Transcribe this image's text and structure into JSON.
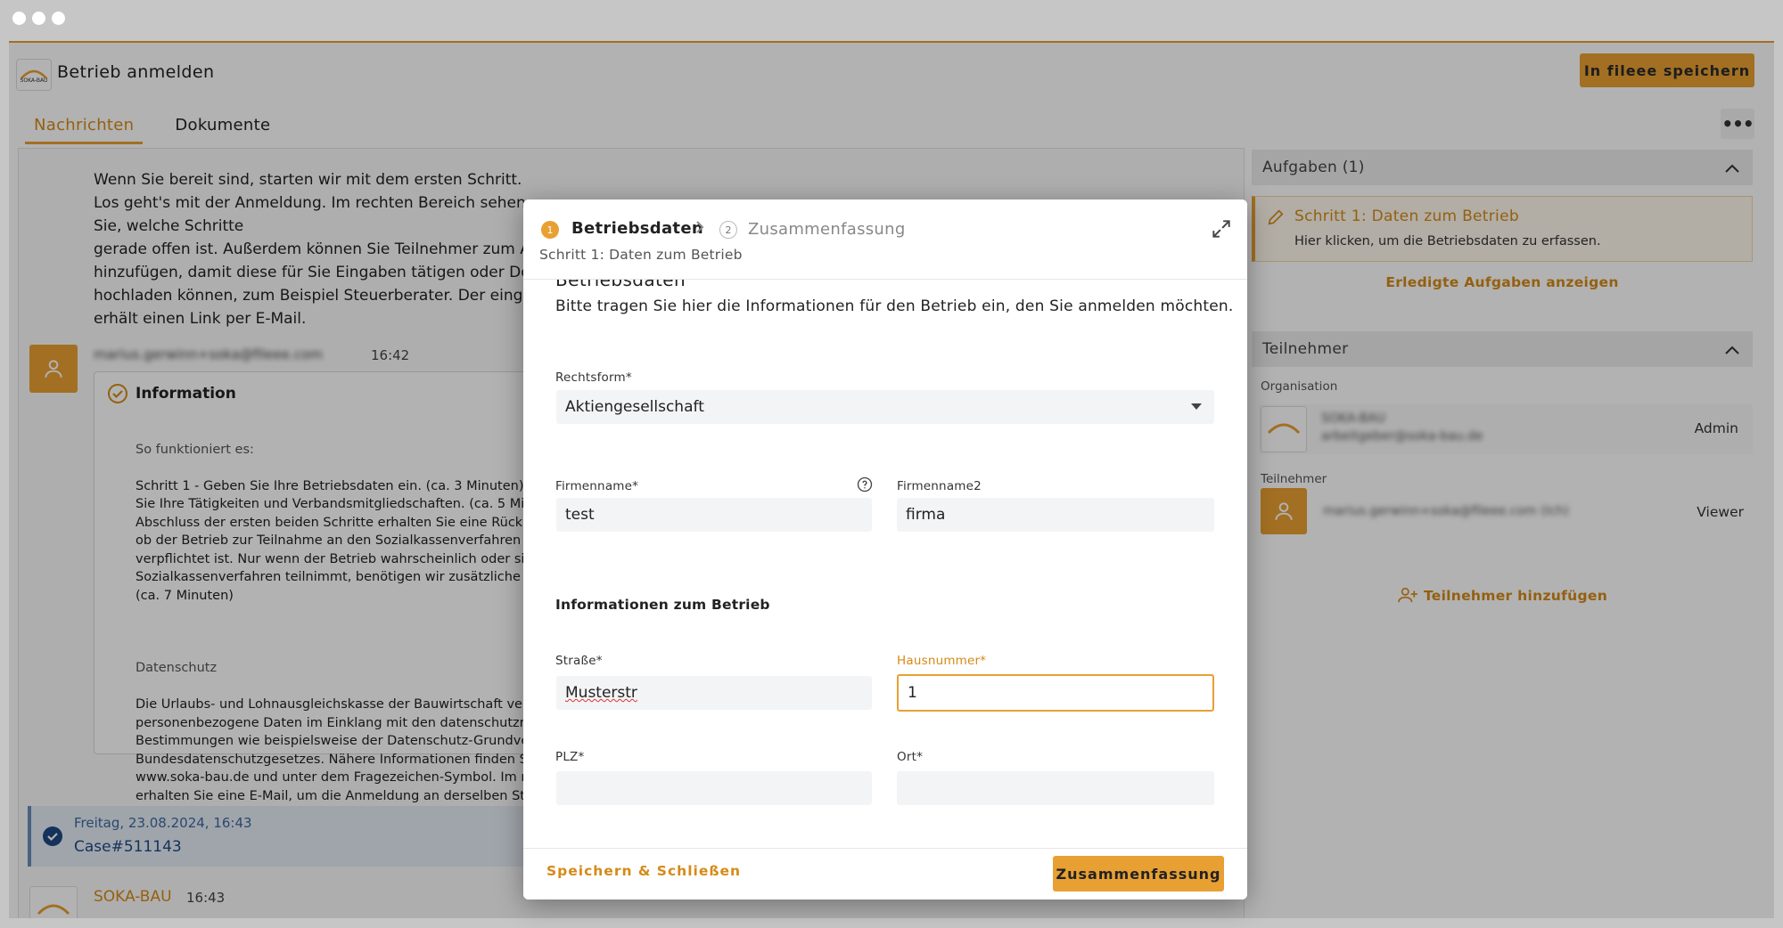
{
  "header": {
    "title": "Betrieb anmelden",
    "save_button": "In fileee speichern",
    "logo_text": "SOKA-BAU"
  },
  "tabs": [
    {
      "label": "Nachrichten",
      "active": true
    },
    {
      "label": "Dokumente",
      "active": false
    }
  ],
  "more_label": "•••",
  "chat": {
    "intro_text": "Wenn Sie bereit sind, starten wir mit dem ersten Schritt.\nLos geht's mit der Anmeldung. Im rechten Bereich sehen Sie, welche Schritte\ngerade offen ist. Außerdem können Sie Teilnehmer zum Ar\nhinzufügen, damit diese für Sie Eingaben tätigen oder Dok\nhochladen können, zum Beispiel Steuerberater. Der eingel\nerhält einen Link per E-Mail.",
    "message": {
      "sender": "marius.gerwinn+soka@fileee.com",
      "time": "16:42",
      "card_title": "Information",
      "how_heading": "So funktioniert es:",
      "how_text": "Schritt 1 - Geben Sie Ihre Betriebsdaten ein. (ca. 3 Minuten) S\nSie Ihre Tätigkeiten und Verbandsmitgliedschaften. (ca. 5 Mi\nAbschluss der ersten beiden Schritte erhalten Sie eine Rückm\nob der Betrieb zur Teilnahme an den Sozialkassenverfahren b\nverpflichtet ist. Nur wenn der Betrieb wahrscheinlich oder si\nSozialkassenverfahren teilnimmt, benötigen wir zusätzliche\n(ca. 7 Minuten)",
      "privacy_heading": "Datenschutz",
      "privacy_text": "Die Urlaubs- und Lohnausgleichskasse der Bauwirtschaft ver\npersonenbezogene Daten im Einklang mit den datenschutzre\nBestimmungen wie beispielsweise der Datenschutz-Grundve\nBundesdatenschutzgesetzes. Nähere Informationen finden S\nwww.soka-bau.de und unter dem Fragezeichen-Symbol. Im n\nerhalten Sie eine E-Mail, um die Anmeldung an derselben St"
    },
    "case": {
      "date": "Freitag, 23.08.2024, 16:43",
      "number": "Case#511143"
    },
    "soka_msg": {
      "name": "SOKA-BAU",
      "time": "16:43"
    }
  },
  "right_panel": {
    "tasks_header": "Aufgaben (1)",
    "task_title": "Schritt 1: Daten zum Betrieb",
    "task_sub": "Hier klicken, um die Betriebsdaten zu erfassen.",
    "done_link": "Erledigte Aufgaben anzeigen",
    "participants_header": "Teilnehmer",
    "org_label": "Organisation",
    "org_name": "SOKA-BAU",
    "org_email": "arbeitgeber@soka-bau.de",
    "org_role": "Admin",
    "participants_label": "Teilnehmer",
    "participant_email": "marius.gerwinn+soka@fileee.com (Ich)",
    "participant_role": "Viewer",
    "add_link": "Teilnehmer hinzufügen"
  },
  "modal": {
    "step1_num": "1",
    "step1_label": "Betriebsdaten",
    "step2_num": "2",
    "step2_label": "Zusammenfassung",
    "subtitle": "Schritt 1: Daten zum Betrieb",
    "section_title": "Betriebsdaten",
    "intro": "Bitte tragen Sie hier die Informationen für den Betrieb ein, den Sie anmelden möchten.",
    "rechtsform_label": "Rechtsform*",
    "rechtsform_value": "Aktiengesellschaft",
    "firmenname_label": "Firmenname*",
    "firmenname_value": "test",
    "firmenname2_label": "Firmenname2",
    "firmenname2_value": "firma",
    "group_title": "Informationen zum Betrieb",
    "strasse_label": "Straße*",
    "strasse_value": "Musterstr",
    "hausnummer_label": "Hausnummer*",
    "hausnummer_value": "1",
    "plz_label": "PLZ*",
    "plz_value": "",
    "ort_label": "Ort*",
    "ort_value": "",
    "save_close": "Speichern & Schließen",
    "next_button": "Zusammenfassung"
  },
  "colors": {
    "accent": "#e8a033",
    "accent_text": "#d58a17",
    "overlay": "rgba(0,0,0,0.30)"
  }
}
